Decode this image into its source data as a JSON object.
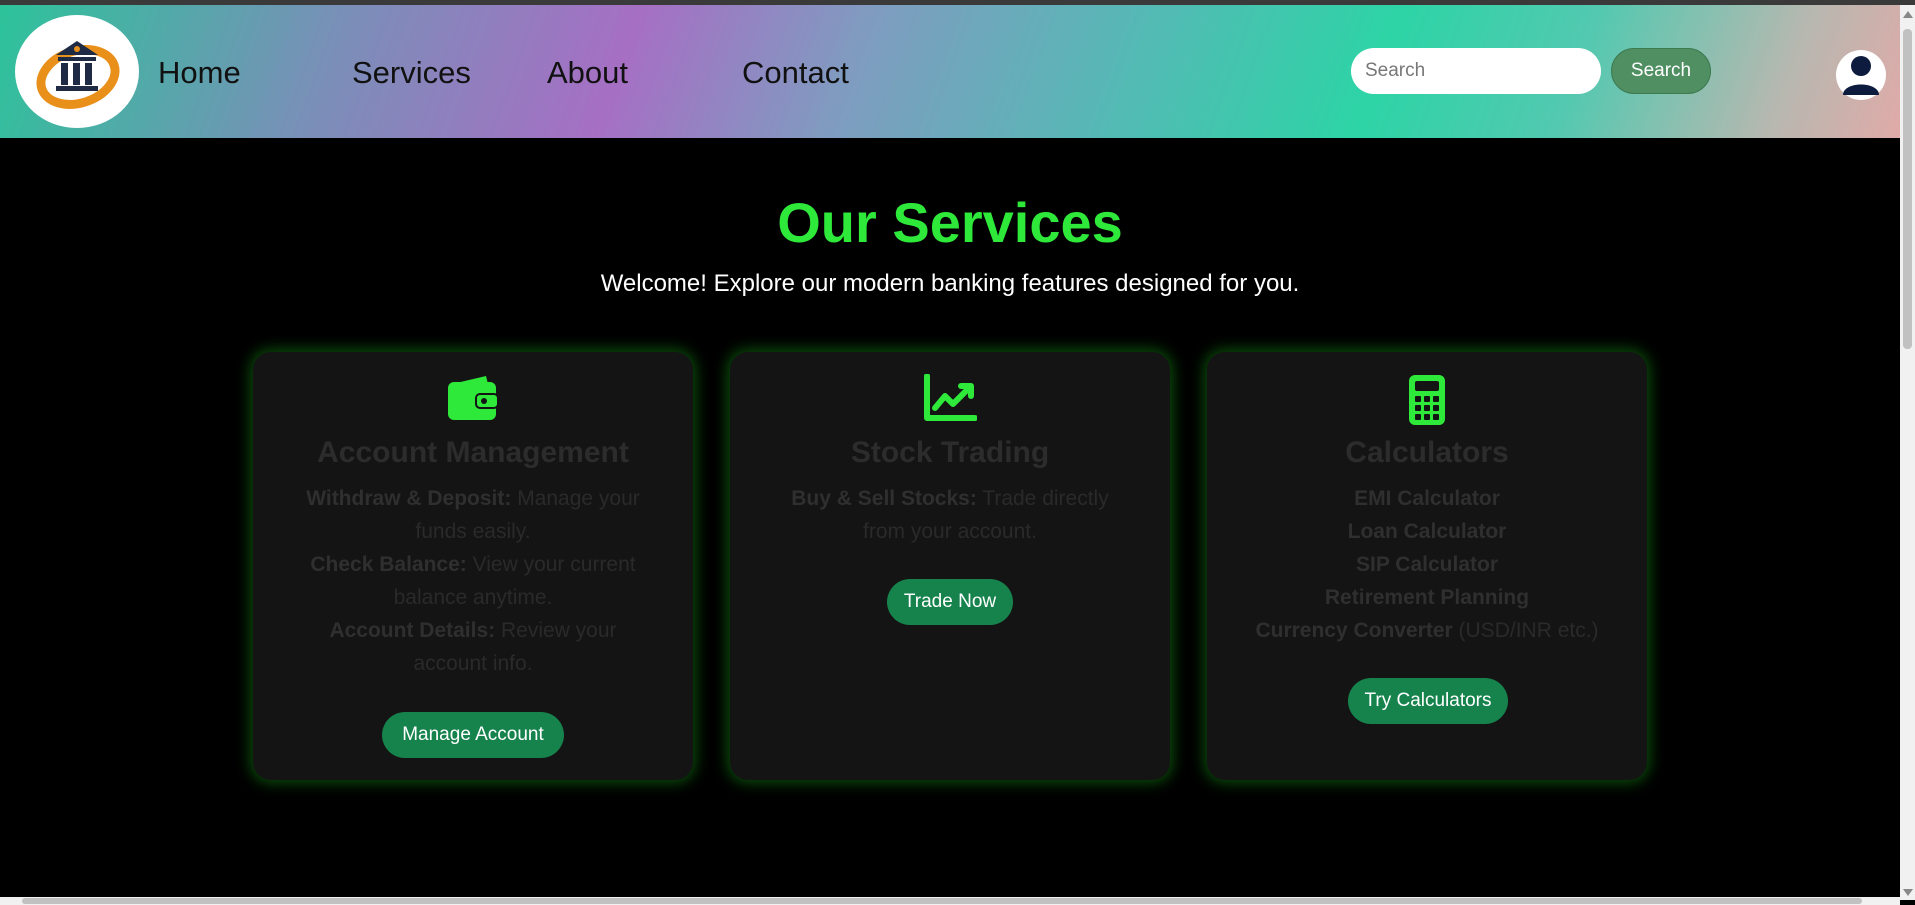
{
  "nav": {
    "links": [
      "Home",
      "Services",
      "About",
      "Contact"
    ],
    "search_placeholder": "Search",
    "search_button": "Search"
  },
  "page": {
    "title": "Our Services",
    "subtitle": "Welcome! Explore our modern banking features designed for you."
  },
  "cards": {
    "account": {
      "icon": "wallet-icon",
      "title": "Account Management",
      "line1_label": "Withdraw & Deposit:",
      "line1_text": " Manage your funds easily.",
      "line2_label": "Check Balance:",
      "line2_text": " View your current balance anytime.",
      "line3_label": "Account Details:",
      "line3_text": " Review your account info.",
      "button": "Manage Account"
    },
    "stock": {
      "icon": "chart-line-icon",
      "title": "Stock Trading",
      "line1_label": "Buy & Sell Stocks:",
      "line1_text": " Trade directly from your account.",
      "button": "Trade Now"
    },
    "calc": {
      "icon": "calculator-icon",
      "title": "Calculators",
      "items": [
        "EMI Calculator",
        "Loan Calculator",
        "SIP Calculator",
        "Retirement Planning"
      ],
      "last_label": "Currency Converter",
      "last_text": " (USD/INR etc.)",
      "button": "Try Calculators"
    }
  },
  "colors": {
    "accent_green": "#2ee83a",
    "button_green": "#16834d",
    "search_button": "#4f8f62"
  }
}
